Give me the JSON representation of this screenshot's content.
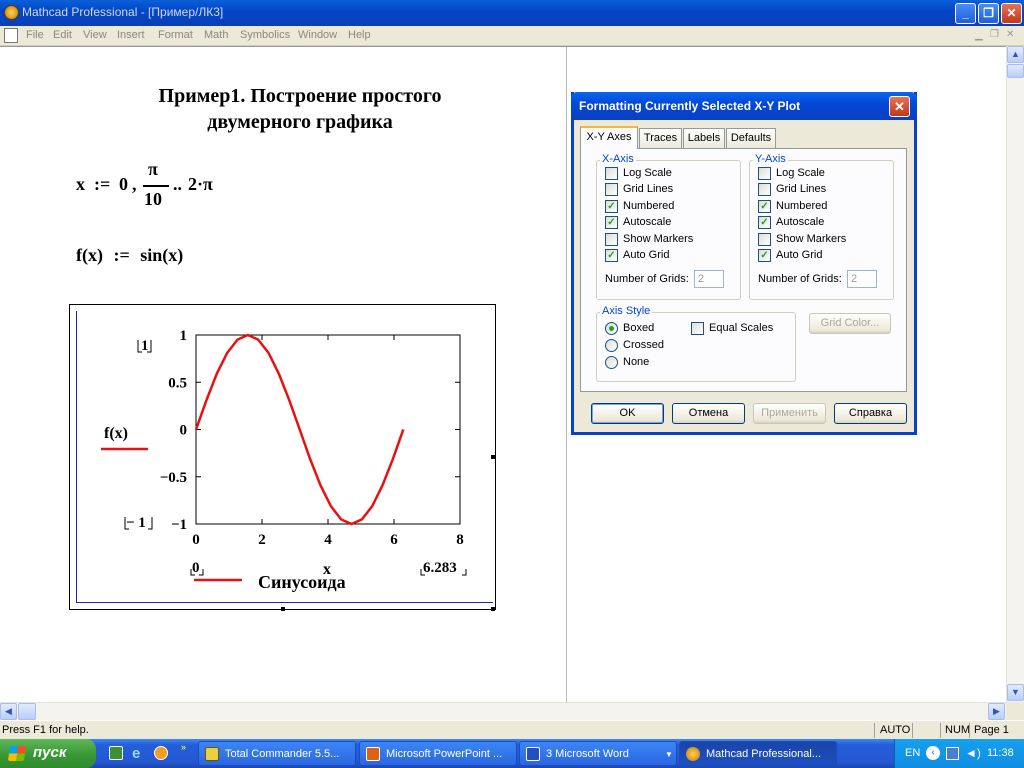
{
  "window": {
    "title": "Mathcad Professional - [Пример/ЛК3]"
  },
  "menu": [
    "File",
    "Edit",
    "View",
    "Insert",
    "Format",
    "Math",
    "Symbolics",
    "Window",
    "Help"
  ],
  "worksheet": {
    "heading_line1": "Пример1. Построение простого",
    "heading_line2": "двумерного графика",
    "range_def": {
      "var": "x",
      "assign": ":=",
      "start": "0",
      "step_num": "π",
      "step_den": "10",
      "range_op": "..",
      "end": "2·π"
    },
    "func_def": {
      "lhs": "f(x)",
      "assign": ":=",
      "rhs": "sin(x)"
    }
  },
  "plot": {
    "y_axis_label": "f(x)",
    "x_axis_label": "x",
    "y_top_limit": "1",
    "y_bottom_limit": "− 1",
    "x_left_limit": "0",
    "x_right_limit": "6.283",
    "legend": "Синусоида",
    "trace_color": "#e81010"
  },
  "chart_data": {
    "type": "line",
    "title": "",
    "xlabel": "x",
    "ylabel": "f(x)",
    "xlim": [
      0,
      8
    ],
    "ylim": [
      -1,
      1
    ],
    "xticks": [
      "0",
      "2",
      "4",
      "6",
      "8"
    ],
    "yticks": [
      "1",
      "0.5",
      "0",
      "-0.5",
      "-1"
    ],
    "series": [
      {
        "name": "Синусоида",
        "x": [
          0,
          0.314,
          0.628,
          0.942,
          1.257,
          1.571,
          1.885,
          2.199,
          2.513,
          2.827,
          3.142,
          3.456,
          3.77,
          4.084,
          4.398,
          4.712,
          5.027,
          5.341,
          5.655,
          5.969,
          6.283
        ],
        "y": [
          0,
          0.309,
          0.588,
          0.809,
          0.951,
          1,
          0.951,
          0.809,
          0.588,
          0.309,
          0,
          -0.309,
          -0.588,
          -0.809,
          -0.951,
          -1,
          -0.951,
          -0.809,
          -0.588,
          -0.309,
          0
        ]
      }
    ]
  },
  "dialog": {
    "title": "Formatting Currently Selected X-Y Plot",
    "tabs": [
      "X-Y Axes",
      "Traces",
      "Labels",
      "Defaults"
    ],
    "x_axis": {
      "title": "X-Axis",
      "options": [
        {
          "label": "Log Scale",
          "checked": false
        },
        {
          "label": "Grid Lines",
          "checked": false
        },
        {
          "label": "Numbered",
          "checked": true
        },
        {
          "label": "Autoscale",
          "checked": true
        },
        {
          "label": "Show Markers",
          "checked": false
        },
        {
          "label": "Auto Grid",
          "checked": true
        }
      ],
      "grids_label": "Number of Grids:",
      "grids_value": "2"
    },
    "y_axis": {
      "title": "Y-Axis",
      "options": [
        {
          "label": "Log Scale",
          "checked": false
        },
        {
          "label": "Grid Lines",
          "checked": false
        },
        {
          "label": "Numbered",
          "checked": true
        },
        {
          "label": "Autoscale",
          "checked": true
        },
        {
          "label": "Show Markers",
          "checked": false
        },
        {
          "label": "Auto Grid",
          "checked": true
        }
      ],
      "grids_label": "Number of Grids:",
      "grids_value": "2"
    },
    "axis_style": {
      "title": "Axis Style",
      "options": [
        "Boxed",
        "Crossed",
        "None"
      ],
      "selected": "Boxed",
      "equal_scales": "Equal Scales"
    },
    "grid_color": "Grid Color...",
    "buttons": {
      "ok": "OK",
      "cancel": "Отмена",
      "apply": "Применить",
      "help": "Справка"
    }
  },
  "status": {
    "help": "Press F1 for help.",
    "mode": "AUTO",
    "num": "NUM",
    "page": "Page 1"
  },
  "taskbar": {
    "start": "пуск",
    "tasks": [
      "Total Commander 5.5...",
      "Microsoft PowerPoint ...",
      "3 Microsoft Word",
      "Mathcad Professional..."
    ],
    "lang": "EN",
    "clock": "11:38"
  }
}
